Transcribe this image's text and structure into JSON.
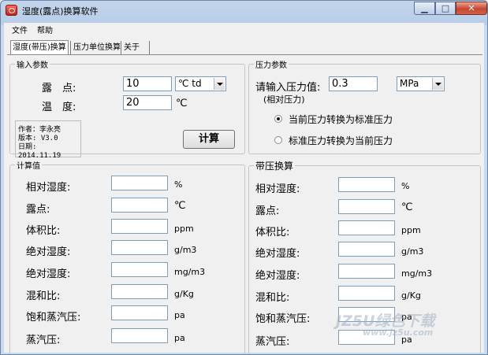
{
  "window": {
    "title": "湿度(露点)换算软件"
  },
  "menu": {
    "file": "文件",
    "help": "帮助"
  },
  "tabs": [
    {
      "label": "湿度(带压)换算",
      "active": true
    },
    {
      "label": "压力单位换算",
      "active": false
    },
    {
      "label": "关于",
      "active": false
    }
  ],
  "input_group": {
    "legend": "输入参数",
    "dewpoint_label": "露　点:",
    "dewpoint_value": "10",
    "dewpoint_unit": "℃ td",
    "temp_label": "温　度:",
    "temp_value": "20",
    "temp_unit": "℃",
    "info_author": "作者：李永亮",
    "info_version": "版本: V3.0",
    "info_date": "日期: 2014.11.19",
    "calc_button": "计算"
  },
  "pressure_group": {
    "legend": "压力参数",
    "prompt": "请输入压力值:",
    "value": "0.3",
    "unit": "MPa",
    "note": "(相对压力)",
    "options": [
      {
        "label": "当前压力转换为标准压力",
        "selected": true
      },
      {
        "label": "标准压力转换为当前压力",
        "selected": false
      }
    ]
  },
  "calc_group": {
    "legend": "计算值",
    "rows": [
      {
        "label": "相对湿度:",
        "unit": "%"
      },
      {
        "label": "露点:",
        "unit": "℃"
      },
      {
        "label": "体积比:",
        "unit": "ppm"
      },
      {
        "label": "绝对湿度:",
        "unit": "g/m3"
      },
      {
        "label": "绝对湿度:",
        "unit": "mg/m3"
      },
      {
        "label": "混和比:",
        "unit": "g/Kg"
      },
      {
        "label": "饱和蒸汽压:",
        "unit": "pa"
      },
      {
        "label": "蒸汽压:",
        "unit": "pa"
      }
    ]
  },
  "press_calc_group": {
    "legend": "带压换算",
    "rows": [
      {
        "label": "相对湿度:",
        "unit": "%"
      },
      {
        "label": "露点:",
        "unit": "℃"
      },
      {
        "label": "体积比:",
        "unit": "ppm"
      },
      {
        "label": "绝对湿度:",
        "unit": "g/m3"
      },
      {
        "label": "绝对湿度:",
        "unit": "mg/m3"
      },
      {
        "label": "混和比:",
        "unit": "g/Kg"
      },
      {
        "label": "饱和蒸汽压:",
        "unit": "pa"
      },
      {
        "label": "蒸汽压:",
        "unit": "pa"
      }
    ]
  },
  "watermark": {
    "line1": "JZ5U绿色下载",
    "line2": "www.jz5u.com"
  }
}
